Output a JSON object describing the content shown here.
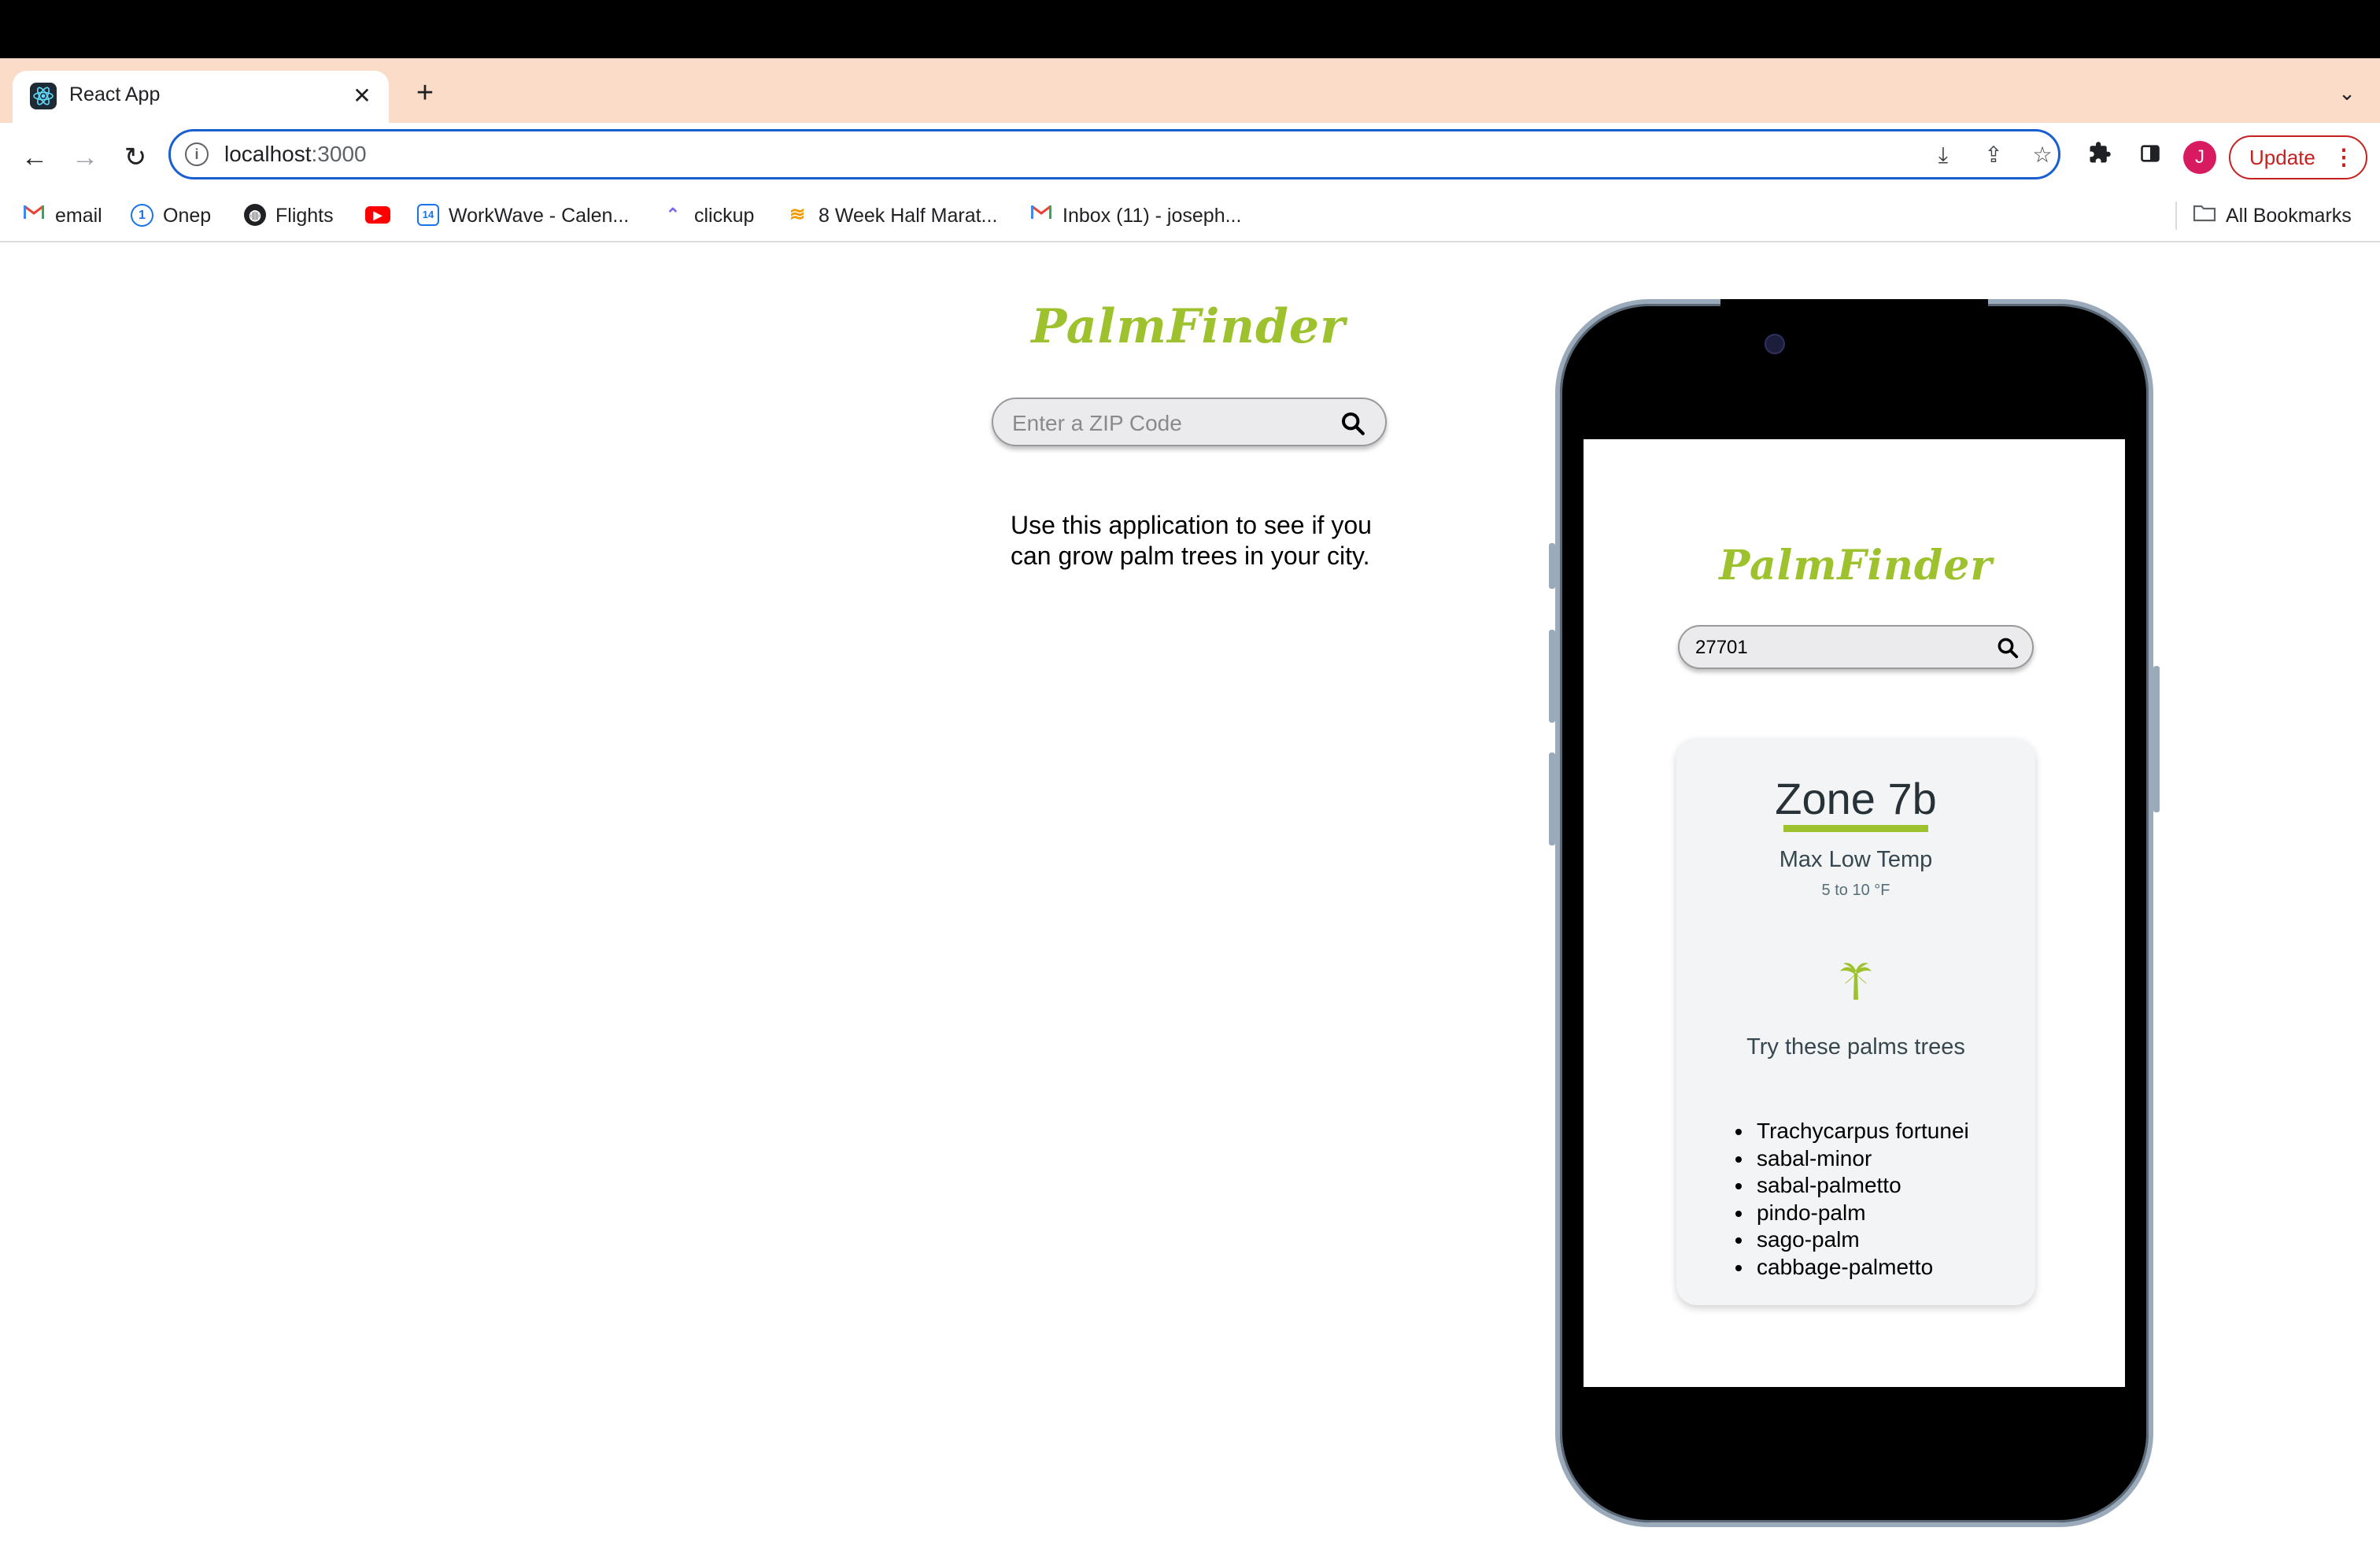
{
  "browser": {
    "tab_title": "React App",
    "url_host": "localhost",
    "url_port": ":3000",
    "update_label": "Update",
    "avatar_initial": "J",
    "accent_color": "#1a5fd1"
  },
  "bookmarks": [
    {
      "label": "email",
      "icon": "gmail-icon"
    },
    {
      "label": "Onep",
      "icon": "onepassword-icon"
    },
    {
      "label": "Flights",
      "icon": "globe-icon"
    },
    {
      "label": "",
      "icon": "youtube-icon"
    },
    {
      "label": "WorkWave - Calen...",
      "icon": "calendar-icon"
    },
    {
      "label": "clickup",
      "icon": "clickup-icon"
    },
    {
      "label": "8 Week Half Marat...",
      "icon": "runner-icon"
    },
    {
      "label": "Inbox (11) - joseph...",
      "icon": "gmail-icon"
    }
  ],
  "all_bookmarks_label": "All Bookmarks",
  "app": {
    "logo": "PalmFinder",
    "brand_color": "#9dc22e",
    "search_placeholder": "Enter a ZIP Code",
    "description": "Use this application to see if you can grow palm trees in your city."
  },
  "phone": {
    "logo": "PalmFinder",
    "search_value": "27701",
    "zone": "Zone 7b",
    "max_low_label": "Max Low Temp",
    "max_low_range": "5 to 10 °F",
    "try_label": "Try these palms trees",
    "palms": [
      "Trachycarpus fortunei",
      "sabal-minor",
      "sabal-palmetto",
      "pindo-palm",
      "sago-palm",
      "cabbage-palmetto"
    ]
  }
}
